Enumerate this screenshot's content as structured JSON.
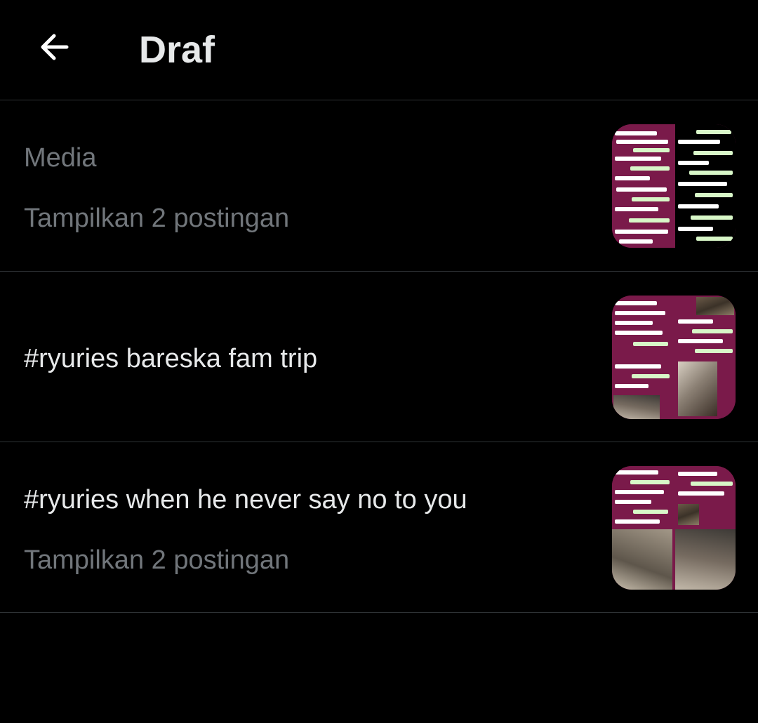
{
  "header": {
    "title": "Draf",
    "back_icon": "arrow-left-icon"
  },
  "drafts": [
    {
      "title": "Media",
      "subtitle": "Tampilkan 2 postingan",
      "thumbnail": "chat-screenshots-collage"
    },
    {
      "title": "#ryuries bareska fam trip",
      "thumbnail": "chat-and-photos-collage"
    },
    {
      "title": "#ryuries when he never say no to you",
      "subtitle": "Tampilkan 2 postingan",
      "thumbnail": "chat-and-selfies-collage"
    }
  ],
  "colors": {
    "background": "#000000",
    "primary_text": "#e7e9ea",
    "secondary_text": "#71767b",
    "divider": "#2f3336",
    "thumb_accent": "#7a1a4a"
  }
}
